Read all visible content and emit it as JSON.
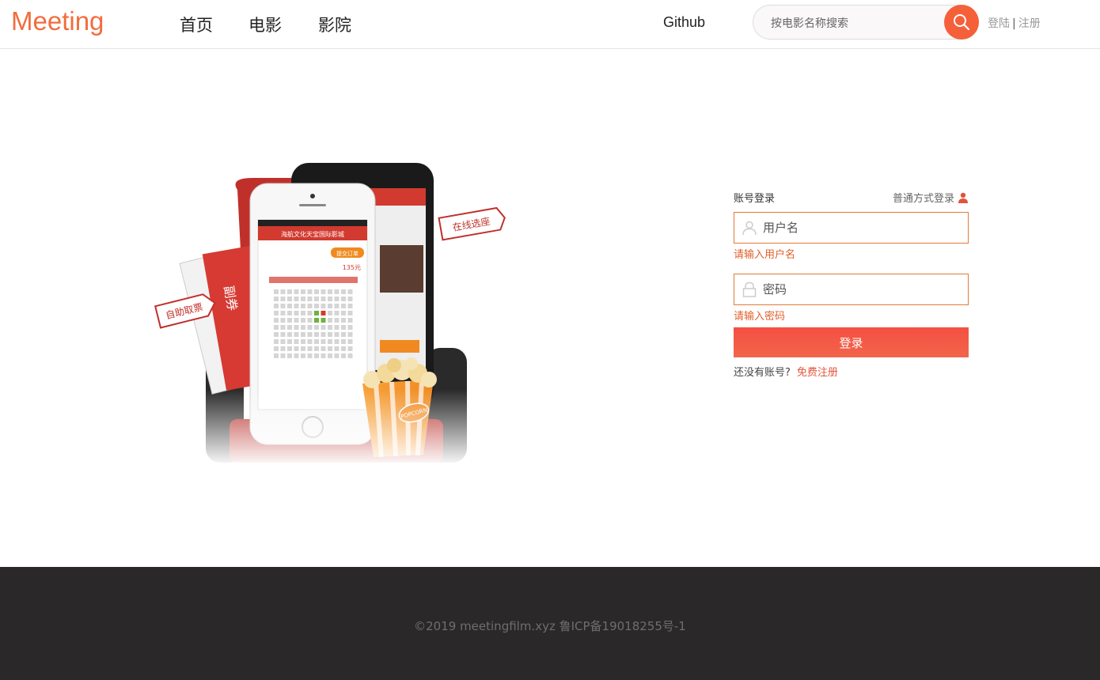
{
  "header": {
    "logo": "Meeting",
    "nav": [
      {
        "label": "首页"
      },
      {
        "label": "电影"
      },
      {
        "label": "影院"
      }
    ],
    "github": "Github",
    "search": {
      "placeholder": "按电影名称搜索",
      "value": ""
    },
    "auth": {
      "login": "登陆",
      "separator": "|",
      "register": "注册"
    }
  },
  "hero": {
    "stamp_left": "自助取票",
    "stamp_right": "在线选座",
    "phone_cinema": "海航文化天宝国际影城",
    "phone_price": "135元",
    "phone_button": "提交订单",
    "popcorn_label": "POPCORN"
  },
  "login": {
    "title": "账号登录",
    "switch_label": "普通方式登录",
    "username": {
      "placeholder": "用户名",
      "value": "",
      "error": "请输入用户名"
    },
    "password": {
      "placeholder": "密码",
      "value": "",
      "error": "请输入密码"
    },
    "submit": "登录",
    "no_account": "还没有账号?",
    "register_link": "免费注册"
  },
  "footer": {
    "copyright": "©2019 meetingfilm.xyz 鲁ICP备19018255号-1"
  },
  "colors": {
    "brand": "#f26d3d",
    "accent": "#f5603a",
    "field_border": "#e07a3a",
    "error": "#e0602a",
    "footer_bg": "#2a2829"
  },
  "icons": [
    "search-icon",
    "user-icon",
    "lock-icon",
    "person-icon"
  ]
}
